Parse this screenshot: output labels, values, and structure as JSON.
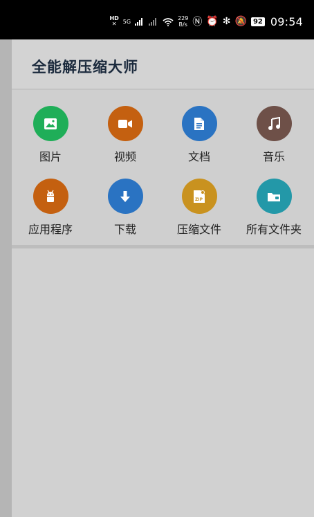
{
  "status_bar": {
    "hd_label": "HD",
    "network_5g": "5G",
    "net_speed_value": "229",
    "net_speed_unit": "B/s",
    "battery": "92",
    "time": "09:54"
  },
  "header": {
    "title": "全能解压缩大师"
  },
  "categories": [
    {
      "label": "图片",
      "icon": "image-icon",
      "color": "#1fae58"
    },
    {
      "label": "视频",
      "icon": "video-camera-icon",
      "color": "#c46010"
    },
    {
      "label": "文档",
      "icon": "document-icon",
      "color": "#2a73c2"
    },
    {
      "label": "音乐",
      "icon": "music-note-icon",
      "color": "#6e5048"
    },
    {
      "label": "应用程序",
      "icon": "android-icon",
      "color": "#c46010"
    },
    {
      "label": "下载",
      "icon": "download-arrow-icon",
      "color": "#2a73c2"
    },
    {
      "label": "压缩文件",
      "icon": "zip-file-icon",
      "color": "#c9921f"
    },
    {
      "label": "所有文件夹",
      "icon": "folder-icon",
      "color": "#2398a8"
    }
  ]
}
